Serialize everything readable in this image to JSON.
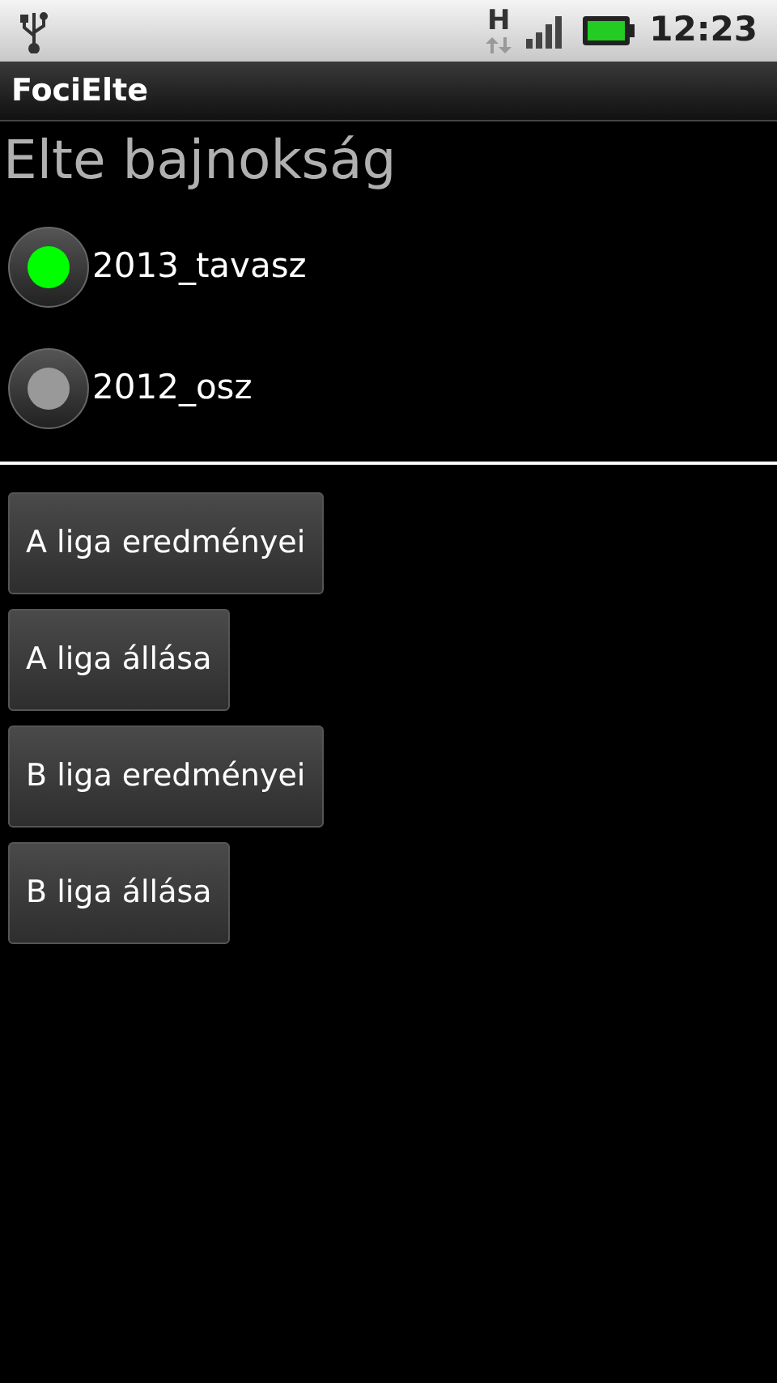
{
  "status_bar": {
    "network": "H",
    "time": "12:23"
  },
  "title_bar": {
    "title": "FociElte"
  },
  "heading": "Elte bajnokság",
  "seasons": [
    {
      "label": "2013_tavasz",
      "selected": true
    },
    {
      "label": "2012_osz",
      "selected": false
    }
  ],
  "buttons": [
    {
      "label": "A liga eredményei"
    },
    {
      "label": "A liga állása"
    },
    {
      "label": "B liga eredményei"
    },
    {
      "label": "B liga állása"
    }
  ]
}
